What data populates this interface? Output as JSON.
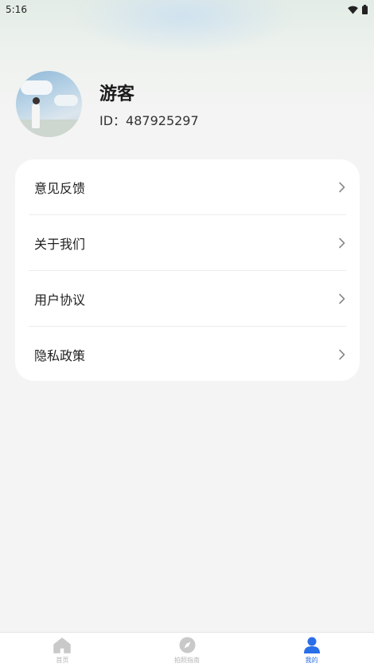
{
  "status_bar": {
    "time": "5:16",
    "icons": [
      "wifi-icon",
      "battery-icon"
    ]
  },
  "profile": {
    "name": "游客",
    "id_text": "ID：487925297"
  },
  "menu": {
    "items": [
      {
        "label": "意见反馈",
        "icon": "chevron-right-icon"
      },
      {
        "label": "关于我们",
        "icon": "chevron-right-icon"
      },
      {
        "label": "用户协议",
        "icon": "chevron-right-icon"
      },
      {
        "label": "隐私政策",
        "icon": "chevron-right-icon"
      }
    ]
  },
  "tab_bar": {
    "tabs": [
      {
        "label": "首页",
        "icon": "home-icon",
        "active": false
      },
      {
        "label": "拍照指南",
        "icon": "compass-icon",
        "active": false
      },
      {
        "label": "我的",
        "icon": "person-icon",
        "active": true
      }
    ]
  },
  "colors": {
    "accent": "#2a6ee8",
    "background": "#f4f4f4",
    "inactive_icon": "#c9c9c9"
  }
}
